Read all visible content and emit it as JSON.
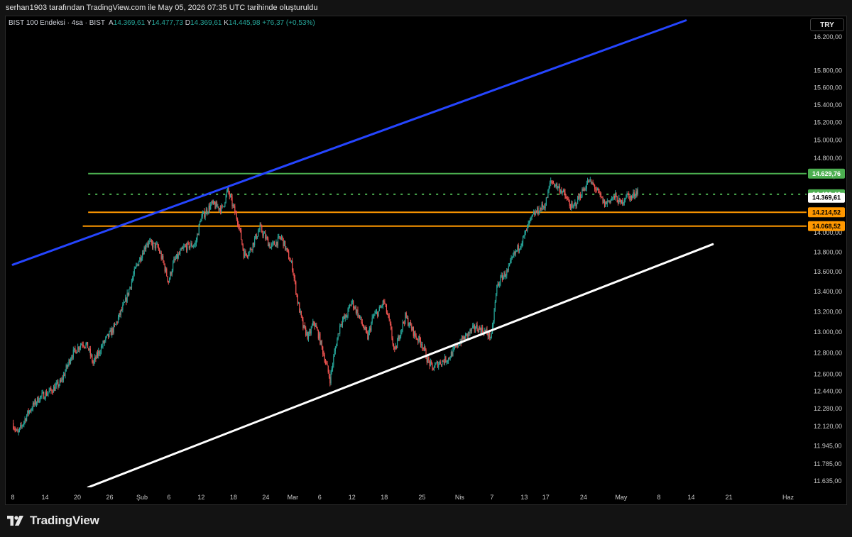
{
  "caption": "serhan1903 tarafından TradingView.com ile May 05, 2026 07:35 UTC tarihinde oluşturuldu",
  "legend": {
    "symbol": "BIST 100 Endeksi · 4sa · BIST",
    "open_label": "A",
    "open": "14.369,61",
    "high_label": "Y",
    "high": "14.477,73",
    "low_label": "D",
    "low": "14.369,61",
    "close_label": "K",
    "close": "14.445,98",
    "change": "+76,37 (+0,53%)"
  },
  "currency": "TRY",
  "brand": "TradingView",
  "colors": {
    "up": "#26a69a",
    "down": "#ef5350",
    "resistance": "#4caf50",
    "support": "#ff9800",
    "upper_trend": "#2545ff",
    "lower_trend": "#ffffff"
  },
  "chart_data": {
    "type": "candlestick",
    "symbol": "BIST 100 Endeksi",
    "interval": "4sa",
    "y_scale": "log",
    "ylim": [
      11580,
      16450
    ],
    "y_ticks": [
      16200,
      15800,
      15600,
      15400,
      15200,
      15000,
      14800,
      14600,
      14400,
      14200,
      14000,
      13800,
      13600,
      13400,
      13200,
      13000,
      12800,
      12600,
      12440,
      12280,
      12120,
      11945,
      11785,
      11635
    ],
    "y_tick_labels": [
      "16.200,00",
      "15.800,00",
      "15.600,00",
      "15.400,00",
      "15.200,00",
      "15.000,00",
      "14.800,00",
      "14.600,00",
      "14.400,00",
      "14.200,00",
      "14.000,00",
      "13.800,00",
      "13.600,00",
      "13.400,00",
      "13.200,00",
      "13.000,00",
      "12.800,00",
      "12.600,00",
      "12.440,00",
      "12.280,00",
      "12.120,00",
      "11.945,00",
      "11.785,00",
      "11.635,00"
    ],
    "x_range": [
      "2026-01-08",
      "2026-06-01"
    ],
    "x_ticks": [
      {
        "date": "2026-01-08",
        "label": "8"
      },
      {
        "date": "2026-01-14",
        "label": "14"
      },
      {
        "date": "2026-01-20",
        "label": "20"
      },
      {
        "date": "2026-01-26",
        "label": "26"
      },
      {
        "date": "2026-02-01",
        "label": "Şub"
      },
      {
        "date": "2026-02-06",
        "label": "6"
      },
      {
        "date": "2026-02-12",
        "label": "12"
      },
      {
        "date": "2026-02-18",
        "label": "18"
      },
      {
        "date": "2026-02-24",
        "label": "24"
      },
      {
        "date": "2026-03-01",
        "label": "Mar"
      },
      {
        "date": "2026-03-06",
        "label": "6"
      },
      {
        "date": "2026-03-12",
        "label": "12"
      },
      {
        "date": "2026-03-18",
        "label": "18"
      },
      {
        "date": "2026-03-25",
        "label": "25"
      },
      {
        "date": "2026-04-01",
        "label": "Nis"
      },
      {
        "date": "2026-04-07",
        "label": "7"
      },
      {
        "date": "2026-04-13",
        "label": "13"
      },
      {
        "date": "2026-04-17",
        "label": "17"
      },
      {
        "date": "2026-04-24",
        "label": "24"
      },
      {
        "date": "2026-05-01",
        "label": "May"
      },
      {
        "date": "2026-05-08",
        "label": "8"
      },
      {
        "date": "2026-05-14",
        "label": "14"
      },
      {
        "date": "2026-05-21",
        "label": "21"
      },
      {
        "date": "2026-06-01",
        "label": "Haz"
      }
    ],
    "price_path": [
      [
        "2026-01-08",
        12150
      ],
      [
        "2026-01-09",
        12050
      ],
      [
        "2026-01-11",
        12250
      ],
      [
        "2026-01-13",
        12380
      ],
      [
        "2026-01-15",
        12440
      ],
      [
        "2026-01-17",
        12520
      ],
      [
        "2026-01-19",
        12780
      ],
      [
        "2026-01-21",
        12900
      ],
      [
        "2026-01-22",
        12860
      ],
      [
        "2026-01-23",
        12700
      ],
      [
        "2026-01-25",
        12900
      ],
      [
        "2026-01-27",
        13050
      ],
      [
        "2026-01-29",
        13300
      ],
      [
        "2026-01-31",
        13650
      ],
      [
        "2026-02-02",
        13900
      ],
      [
        "2026-02-04",
        13850
      ],
      [
        "2026-02-05",
        13700
      ],
      [
        "2026-02-06",
        13500
      ],
      [
        "2026-02-07",
        13700
      ],
      [
        "2026-02-09",
        13850
      ],
      [
        "2026-02-11",
        13880
      ],
      [
        "2026-02-12",
        14150
      ],
      [
        "2026-02-14",
        14300
      ],
      [
        "2026-02-16",
        14250
      ],
      [
        "2026-02-17",
        14450
      ],
      [
        "2026-02-19",
        14100
      ],
      [
        "2026-02-20",
        13780
      ],
      [
        "2026-02-21",
        13800
      ],
      [
        "2026-02-23",
        14050
      ],
      [
        "2026-02-25",
        13850
      ],
      [
        "2026-02-27",
        13950
      ],
      [
        "2026-03-01",
        13650
      ],
      [
        "2026-03-02",
        13300
      ],
      [
        "2026-03-03",
        13050
      ],
      [
        "2026-03-04",
        12950
      ],
      [
        "2026-03-05",
        13100
      ],
      [
        "2026-03-06",
        12950
      ],
      [
        "2026-03-08",
        12550
      ],
      [
        "2026-03-09",
        12850
      ],
      [
        "2026-03-10",
        13100
      ],
      [
        "2026-03-11",
        13150
      ],
      [
        "2026-03-12",
        13300
      ],
      [
        "2026-03-13",
        13200
      ],
      [
        "2026-03-15",
        12950
      ],
      [
        "2026-03-16",
        13150
      ],
      [
        "2026-03-17",
        13200
      ],
      [
        "2026-03-18",
        13300
      ],
      [
        "2026-03-19",
        13100
      ],
      [
        "2026-03-20",
        12800
      ],
      [
        "2026-03-21",
        13000
      ],
      [
        "2026-03-22",
        13150
      ],
      [
        "2026-03-23",
        13050
      ],
      [
        "2026-03-24",
        12950
      ],
      [
        "2026-03-25",
        12900
      ],
      [
        "2026-03-26",
        12750
      ],
      [
        "2026-03-27",
        12650
      ],
      [
        "2026-03-28",
        12700
      ],
      [
        "2026-03-30",
        12750
      ],
      [
        "2026-04-01",
        12900
      ],
      [
        "2026-04-02",
        12950
      ],
      [
        "2026-04-03",
        13000
      ],
      [
        "2026-04-04",
        13050
      ],
      [
        "2026-04-06",
        13000
      ],
      [
        "2026-04-07",
        12950
      ],
      [
        "2026-04-08",
        13450
      ],
      [
        "2026-04-09",
        13550
      ],
      [
        "2026-04-10",
        13600
      ],
      [
        "2026-04-11",
        13750
      ],
      [
        "2026-04-13",
        13950
      ],
      [
        "2026-04-14",
        14100
      ],
      [
        "2026-04-15",
        14200
      ],
      [
        "2026-04-16",
        14250
      ],
      [
        "2026-04-17",
        14300
      ],
      [
        "2026-04-18",
        14550
      ],
      [
        "2026-04-19",
        14500
      ],
      [
        "2026-04-20",
        14450
      ],
      [
        "2026-04-21",
        14350
      ],
      [
        "2026-04-22",
        14250
      ],
      [
        "2026-04-23",
        14350
      ],
      [
        "2026-04-24",
        14450
      ],
      [
        "2026-04-25",
        14550
      ],
      [
        "2026-04-26",
        14500
      ],
      [
        "2026-04-27",
        14400
      ],
      [
        "2026-04-28",
        14300
      ],
      [
        "2026-04-29",
        14350
      ],
      [
        "2026-04-30",
        14380
      ],
      [
        "2026-05-01",
        14300
      ],
      [
        "2026-05-02",
        14400
      ],
      [
        "2026-05-03",
        14370
      ],
      [
        "2026-05-04",
        14446
      ]
    ],
    "horizontal_levels": [
      {
        "value": 14629.76,
        "label": "14.629,76",
        "color": "#4caf50",
        "style": "solid",
        "from": "2026-01-22"
      },
      {
        "value": 14406.46,
        "label": "14.406,46",
        "color": "#4caf50",
        "style": "dotted",
        "from": "2026-01-22"
      },
      {
        "value": 14214.52,
        "label": "14.214,52",
        "color": "#ff9800",
        "style": "solid",
        "from": "2026-01-22"
      },
      {
        "value": 14068.52,
        "label": "14.068,52",
        "color": "#ff9800",
        "style": "solid",
        "from": "2026-01-21"
      }
    ],
    "current_price": {
      "value": 14369.61,
      "label": "14.369,61"
    },
    "trendlines": [
      {
        "color": "#2545ff",
        "points": [
          [
            "2026-01-08",
            13670
          ],
          [
            "2026-05-13",
            16400
          ]
        ]
      },
      {
        "color": "#ffffff",
        "points": [
          [
            "2026-01-22",
            11580
          ],
          [
            "2026-05-18",
            13880
          ]
        ]
      }
    ],
    "grid": false,
    "legend_position": "top-left"
  }
}
